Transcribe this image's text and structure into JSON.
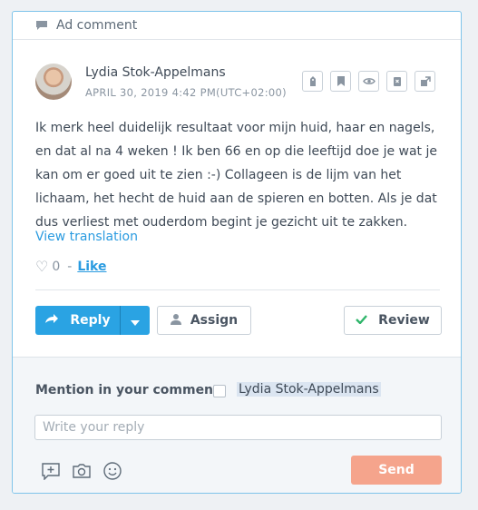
{
  "header": {
    "title": "Ad comment",
    "icon": "comment-icon"
  },
  "comment": {
    "author": "Lydia Stok-Appelmans",
    "date": "APRIL 30, 2019 4:42 PM(UTC+02:00)",
    "text": "Ik merk heel duidelijk resultaat voor mijn huid, haar en nagels, en dat al na 4 weken ! Ik ben 66 en op die leeftijd doe je wat je kan om er goed uit te zien :-) Collageen is de lijm van het lichaam, het hecht de huid aan de spieren en botten. Als je dat dus verliest met ouderdom begint je gezicht uit te zakken.",
    "translate_label": "View translation",
    "like_count": "0",
    "like_label": "Like",
    "action_icons": [
      "tag-icon",
      "bookmark-icon",
      "eye-icon",
      "delete-icon",
      "external-icon"
    ]
  },
  "buttons": {
    "reply": "Reply",
    "assign": "Assign",
    "review": "Review",
    "send": "Send"
  },
  "compose": {
    "mention_label": "Mention in your comment",
    "mention_name": "Lydia Stok-Appelmans",
    "placeholder": "Write your reply",
    "tool_icons": [
      "add-comment-icon",
      "camera-icon",
      "emoji-icon"
    ]
  },
  "colors": {
    "accent": "#2aa3e3",
    "card_border": "#7fc4ea",
    "send": "#f5a48c",
    "review_check": "#2fb56a"
  }
}
